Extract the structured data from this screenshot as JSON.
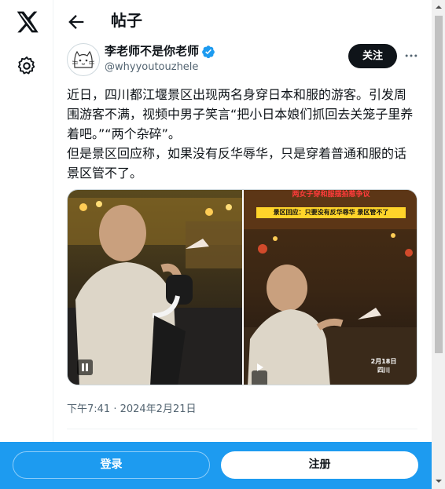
{
  "nav": {
    "logo_icon": "x-logo-icon",
    "settings_icon": "gear-icon"
  },
  "header": {
    "back_icon": "arrow-left-icon",
    "title": "帖子"
  },
  "post": {
    "author": {
      "name": "李老师不是你老师",
      "handle": "@whyyoutouzhele",
      "verified": true
    },
    "follow_label": "关注",
    "more_icon": "more-horizontal-icon",
    "text": "近日，四川都江堰景区出现两名身穿日本和服的游客。引发周围游客不满，视频中男子笑言“把小日本娘们抓回去关笼子里养着吧。”“两个杂碎”。\n但是景区回应称，如果没有反华辱华，只是穿着普通和服的话景区管不了。",
    "media": {
      "left": {
        "control_icon": "pause-icon"
      },
      "right": {
        "control_icon": "play-icon",
        "banner_title": "两女子穿和服摆拍惹争议",
        "banner_caption": "景区回应：只要没有反华辱华 景区管不了",
        "date_stamp": "2月18日",
        "place_stamp": "四川"
      }
    },
    "timestamp": "下午7:41 · 2024年2月21日"
  },
  "bottom_bar": {
    "login_label": "登录",
    "signup_label": "注册"
  },
  "colors": {
    "brand_blue": "#1d9bf0",
    "text_primary": "#0f1419",
    "text_secondary": "#536471"
  }
}
